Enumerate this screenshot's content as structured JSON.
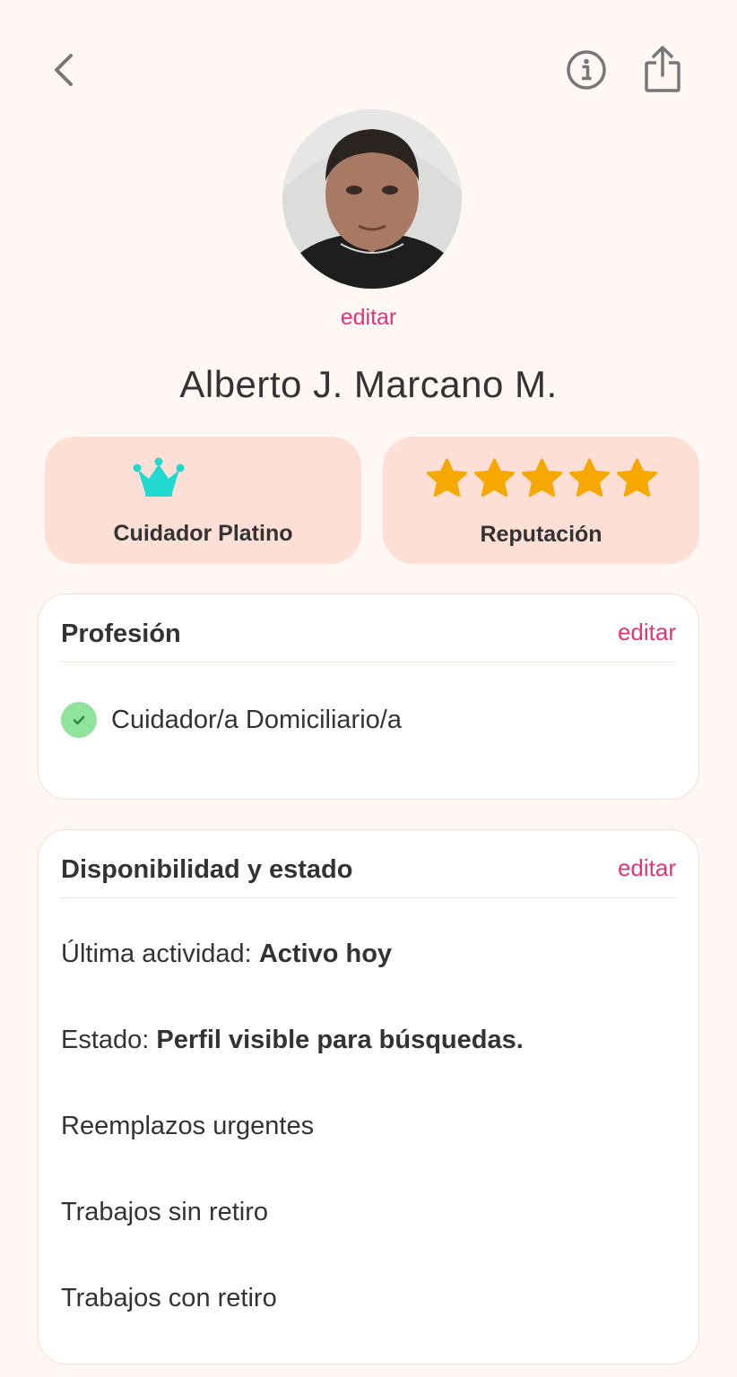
{
  "colors": {
    "accent": "#E2347A",
    "background": "#FEF7F3",
    "badge_bg": "#FDDFD6",
    "crown": "#22D9D2",
    "star": "#F6A800",
    "check_bg": "#8FE39A",
    "check_mark": "#2E8B3A"
  },
  "header": {
    "back_icon": "chevron-left-icon",
    "info_icon": "info-icon",
    "share_icon": "share-icon"
  },
  "profile": {
    "edit_photo_label": "editar",
    "name": "Alberto J. Marcano M."
  },
  "badges": {
    "level": {
      "icon": "crown-icon",
      "label": "Cuidador Platino"
    },
    "reputation": {
      "icon": "star-icon",
      "stars": 5,
      "label": "Reputación"
    }
  },
  "profession": {
    "title": "Profesión",
    "edit_label": "editar",
    "items": [
      {
        "label": "Cuidador/a Domiciliario/a",
        "verified": true
      }
    ]
  },
  "availability": {
    "title": "Disponibilidad y estado",
    "edit_label": "editar",
    "last_activity_label": "Última actividad:",
    "last_activity_value": "Activo hoy",
    "status_label": "Estado:",
    "status_value": "Perfil visible para búsquedas.",
    "options": [
      "Reemplazos urgentes",
      "Trabajos sin retiro",
      "Trabajos con retiro"
    ]
  }
}
